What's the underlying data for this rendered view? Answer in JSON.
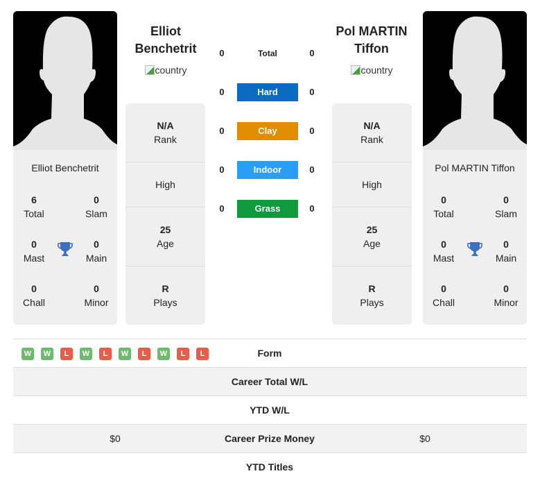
{
  "colors": {
    "hard": "#0a6bc1",
    "clay": "#e08d00",
    "indoor": "#2a9df4",
    "grass": "#0f9a3d",
    "win": "#6cbb6c",
    "loss": "#ec5b45",
    "trophy": "#3b6fbf",
    "card_bg": "#efefef"
  },
  "player1": {
    "header_name_line1": "Elliot",
    "header_name_line2": "Benchetrit",
    "country_alt": "country",
    "card_name": "Elliot Benchetrit",
    "titles": {
      "total": {
        "value": "6",
        "label": "Total"
      },
      "slam": {
        "value": "0",
        "label": "Slam"
      },
      "mast": {
        "value": "0",
        "label": "Mast"
      },
      "main": {
        "value": "0",
        "label": "Main"
      },
      "chall": {
        "value": "0",
        "label": "Chall"
      },
      "minor": {
        "value": "0",
        "label": "Minor"
      }
    },
    "info": {
      "rank": {
        "value": "N/A",
        "label": "Rank"
      },
      "high": {
        "label": "High"
      },
      "age": {
        "value": "25",
        "label": "Age"
      },
      "plays": {
        "value": "R",
        "label": "Plays"
      }
    },
    "form": [
      "W",
      "W",
      "L",
      "W",
      "L",
      "W",
      "L",
      "W",
      "L",
      "L"
    ],
    "career_prize_money": "$0"
  },
  "player2": {
    "header_name_line1": "Pol MARTIN",
    "header_name_line2": "Tiffon",
    "country_alt": "country",
    "card_name": "Pol MARTIN Tiffon",
    "titles": {
      "total": {
        "value": "0",
        "label": "Total"
      },
      "slam": {
        "value": "0",
        "label": "Slam"
      },
      "mast": {
        "value": "0",
        "label": "Mast"
      },
      "main": {
        "value": "0",
        "label": "Main"
      },
      "chall": {
        "value": "0",
        "label": "Chall"
      },
      "minor": {
        "value": "0",
        "label": "Minor"
      }
    },
    "info": {
      "rank": {
        "value": "N/A",
        "label": "Rank"
      },
      "high": {
        "label": "High"
      },
      "age": {
        "value": "25",
        "label": "Age"
      },
      "plays": {
        "value": "R",
        "label": "Plays"
      }
    },
    "career_prize_money": "$0"
  },
  "surfaces": [
    {
      "key": "total",
      "label": "Total",
      "p1": "0",
      "p2": "0"
    },
    {
      "key": "hard",
      "label": "Hard",
      "p1": "0",
      "p2": "0"
    },
    {
      "key": "clay",
      "label": "Clay",
      "p1": "0",
      "p2": "0"
    },
    {
      "key": "indoor",
      "label": "Indoor",
      "p1": "0",
      "p2": "0"
    },
    {
      "key": "grass",
      "label": "Grass",
      "p1": "0",
      "p2": "0"
    }
  ],
  "table": {
    "form_label": "Form",
    "career_total_wl_label": "Career Total W/L",
    "ytd_wl_label": "YTD W/L",
    "career_prize_money_label": "Career Prize Money",
    "ytd_titles_label": "YTD Titles"
  }
}
